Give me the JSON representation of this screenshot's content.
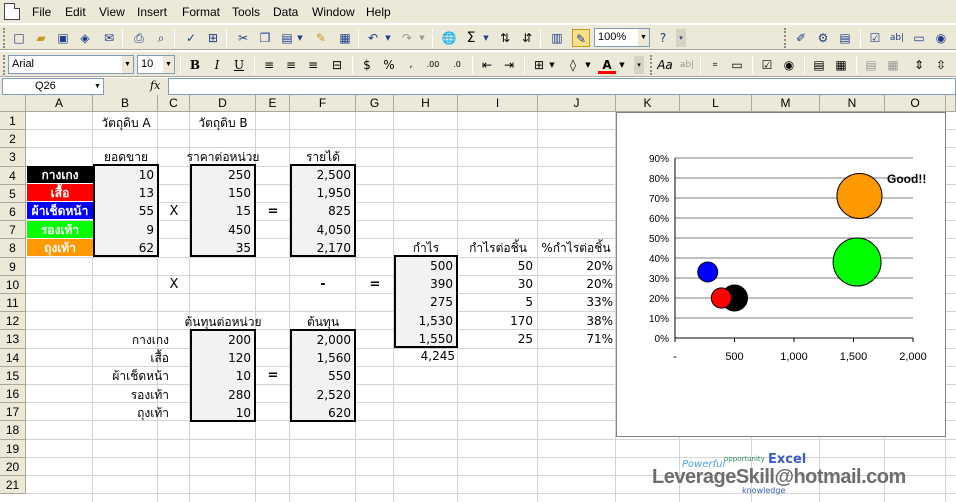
{
  "menubar": {
    "items": [
      {
        "label": "File",
        "name": "menu-file"
      },
      {
        "label": "Edit",
        "name": "menu-edit"
      },
      {
        "label": "View",
        "name": "menu-view"
      },
      {
        "label": "Insert",
        "name": "menu-insert"
      },
      {
        "label": "Format",
        "name": "menu-format"
      },
      {
        "label": "Tools",
        "name": "menu-tools"
      },
      {
        "label": "Data",
        "name": "menu-data"
      },
      {
        "label": "Window",
        "name": "menu-window"
      },
      {
        "label": "Help",
        "name": "menu-help"
      }
    ]
  },
  "standard_toolbar": {
    "zoom": "100%"
  },
  "formatting_toolbar": {
    "font": "Arial",
    "size": "10"
  },
  "formula_bar": {
    "name_box": "Q26",
    "fx": "fx",
    "formula": ""
  },
  "sheet": {
    "columns": [
      "A",
      "B",
      "C",
      "D",
      "E",
      "F",
      "G",
      "H",
      "I",
      "J",
      "K",
      "L",
      "M",
      "N",
      "O"
    ],
    "rows": [
      "1",
      "2",
      "3",
      "4",
      "5",
      "6",
      "7",
      "8",
      "9",
      "10",
      "11",
      "12",
      "13",
      "14",
      "15",
      "16",
      "17",
      "18",
      "19",
      "20",
      "21"
    ],
    "headers": {
      "material_a": "วัตถุดิบ A",
      "material_b": "วัตถุดิบ B",
      "sales": "ยอดขาย",
      "unit_price": "ราคาต่อหน่วย",
      "revenue": "รายได้",
      "profit": "กำไร",
      "profit_increase": "กำไรต่อชิ้น",
      "profit_pct": "%กำไรต่อชิ้น",
      "unit_cost": "ต้นทุนต่อหน่วย",
      "cost": "ต้นทุน"
    },
    "operators": {
      "times1": "X",
      "equals1": "=",
      "times2": "X",
      "minus": "-",
      "equals2": "=",
      "equals3": "="
    },
    "products": [
      {
        "name": "กางเกง",
        "color": "#000000",
        "sales": "10",
        "price": "250",
        "revenue": "2,500",
        "profit": "500",
        "profit_unit": "50",
        "pct": "20%",
        "cost_unit": "200",
        "cost": "2,000"
      },
      {
        "name": "เสื้อ",
        "color": "#ff0000",
        "sales": "13",
        "price": "150",
        "revenue": "1,950",
        "profit": "390",
        "profit_unit": "30",
        "pct": "20%",
        "cost_unit": "120",
        "cost": "1,560"
      },
      {
        "name": "ผ้าเช็ดหน้า",
        "color": "#0000ff",
        "sales": "55",
        "price": "15",
        "revenue": "825",
        "profit": "275",
        "profit_unit": "5",
        "pct": "33%",
        "cost_unit": "10",
        "cost": "550"
      },
      {
        "name": "รองเท้า",
        "color": "#00ff00",
        "sales": "9",
        "price": "450",
        "revenue": "4,050",
        "profit": "1,530",
        "profit_unit": "170",
        "pct": "38%",
        "cost_unit": "280",
        "cost": "2,520"
      },
      {
        "name": "ถุงเท้า",
        "color": "#ff9900",
        "sales": "62",
        "price": "35",
        "revenue": "2,170",
        "profit": "1,550",
        "profit_unit": "25",
        "pct": "71%",
        "cost_unit": "10",
        "cost": "620"
      }
    ],
    "profit_total": "4,245"
  },
  "chart_data": {
    "type": "scatter",
    "subtype": "bubble",
    "y_ticks": [
      "90%",
      "80%",
      "70%",
      "60%",
      "50%",
      "40%",
      "30%",
      "20%",
      "10%",
      "0%"
    ],
    "x_ticks": [
      "-",
      "500",
      "1,000",
      "1,500",
      "2,000"
    ],
    "xlim": [
      0,
      2000
    ],
    "ylim": [
      0,
      0.9
    ],
    "grid": true,
    "annotation": "Good!!",
    "points": [
      {
        "x": 500,
        "y": 0.2,
        "size": 50,
        "color": "#000000"
      },
      {
        "x": 390,
        "y": 0.2,
        "size": 30,
        "color": "#ff0000"
      },
      {
        "x": 275,
        "y": 0.33,
        "size": 5,
        "color": "#0000ff"
      },
      {
        "x": 1530,
        "y": 0.38,
        "size": 170,
        "color": "#00ff00"
      },
      {
        "x": 1550,
        "y": 0.71,
        "size": 150,
        "color": "#ff9900"
      }
    ]
  },
  "watermark": {
    "main": "LeverageSkill@hotmail.com",
    "powerful": "Powerful",
    "opportunity": "opportunity",
    "excel": "Excel",
    "knowledge": "knowledge"
  }
}
